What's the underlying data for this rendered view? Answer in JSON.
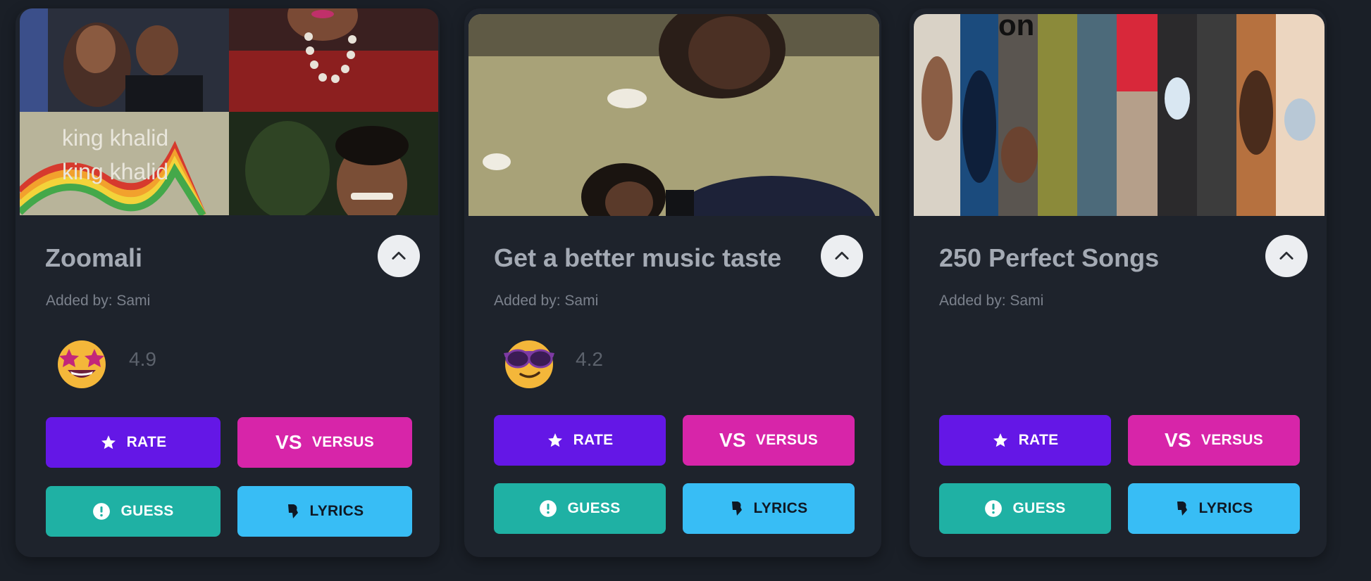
{
  "cards": [
    {
      "title": "Zoomali",
      "added_by": "Added by: Sami",
      "rating": "4.9",
      "emoji": "star-struck-emoji",
      "cover_text": "king khalid",
      "buttons": {
        "rate": "RATE",
        "versus": "VERSUS",
        "guess": "GUESS",
        "lyrics": "LYRICS",
        "vs_mark": "VS"
      }
    },
    {
      "title": "Get a better music taste",
      "added_by": "Added by: Sami",
      "rating": "4.2",
      "emoji": "sunglasses-emoji",
      "buttons": {
        "rate": "RATE",
        "versus": "VERSUS",
        "guess": "GUESS",
        "lyrics": "LYRICS",
        "vs_mark": "VS"
      }
    },
    {
      "title": "250 Perfect Songs",
      "added_by": "Added by: Sami",
      "cover_text": "on",
      "buttons": {
        "rate": "RATE",
        "versus": "VERSUS",
        "guess": "GUESS",
        "lyrics": "LYRICS",
        "vs_mark": "VS"
      }
    }
  ],
  "colors": {
    "background": "#1a1f27",
    "card": "#1e232c",
    "rate": "#6417e6",
    "versus": "#d725a9",
    "guess": "#1fb1a4",
    "lyrics": "#38bdf5"
  }
}
